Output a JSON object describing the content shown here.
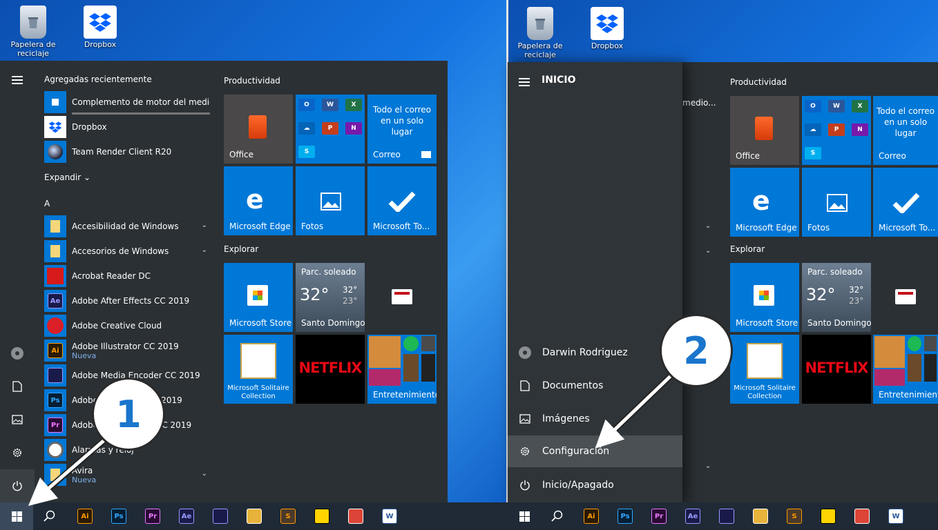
{
  "desktop": {
    "icons": [
      {
        "label": "Papelera de reciclaje",
        "icon": "recycle-bin-icon"
      },
      {
        "label": "Dropbox",
        "icon": "dropbox-icon"
      }
    ]
  },
  "left_menu": {
    "recent_header": "Agregadas recientemente",
    "recent": [
      {
        "label": "Complemento de motor del medio...",
        "color": "#0078d7"
      },
      {
        "label": "Dropbox",
        "color": "#0078d7"
      },
      {
        "label": "Team Render Client R20",
        "color": "#0078d7"
      }
    ],
    "expand_label": "Expandir",
    "section_letter": "A",
    "apps": [
      {
        "label": "Accesibilidad de Windows",
        "icon_text": "",
        "color": "#0078d7",
        "sub": "",
        "chev": "⌄"
      },
      {
        "label": "Accesorios de Windows",
        "icon_text": "",
        "color": "#0078d7",
        "sub": "",
        "chev": "⌄"
      },
      {
        "label": "Acrobat Reader DC",
        "icon_text": "",
        "color": "#0078d7",
        "sub": "",
        "chev": ""
      },
      {
        "label": "Adobe After Effects CC 2019",
        "icon_text": "Ae",
        "color": "#1a1a4a",
        "sub": "",
        "chev": ""
      },
      {
        "label": "Adobe Creative Cloud",
        "icon_text": "",
        "color": "#0078d7",
        "sub": "",
        "chev": ""
      },
      {
        "label": "Adobe Illustrator CC 2019",
        "icon_text": "Ai",
        "color": "#2a1a04",
        "sub": "Nueva",
        "chev": ""
      },
      {
        "label": "Adobe Media Encoder CC 2019",
        "icon_text": "",
        "color": "#1a1a4a",
        "sub": "",
        "chev": ""
      },
      {
        "label": "Adobe Photoshop CC 2019",
        "icon_text": "Ps",
        "color": "#061e33",
        "sub": "",
        "chev": ""
      },
      {
        "label": "Adobe Premiere Pro CC 2019",
        "icon_text": "Pr",
        "color": "#2a0a33",
        "sub": "",
        "chev": ""
      },
      {
        "label": "Alarmas y reloj",
        "icon_text": "",
        "color": "#0078d7",
        "sub": "",
        "chev": ""
      },
      {
        "label": "Avira",
        "icon_text": "",
        "color": "#0078d7",
        "sub": "Nueva",
        "chev": "⌄"
      }
    ]
  },
  "tiles": {
    "productividad": "Productividad",
    "explorar": "Explorar",
    "office": "Office",
    "correo_text": "Todo el correo en un solo lugar",
    "correo": "Correo",
    "edge": "Microsoft Edge",
    "fotos": "Fotos",
    "todo": "Microsoft To...",
    "store": "Microsoft Store",
    "weather_cond": "Parc. soleado",
    "weather_temp": "32°",
    "weather_high": "32°",
    "weather_low": "23°",
    "weather_city": "Santo Domingo",
    "solitaire": "Microsoft Solitaire Collection",
    "netflix": "NETFLIX",
    "entretenimiento": "Entretenimiento",
    "mini_labels": [
      "O",
      "W",
      "X",
      "",
      "P",
      "N",
      "S"
    ]
  },
  "drawer": {
    "title": "INICIO",
    "partial_text": "medio...",
    "user": "Darwin Rodriguez",
    "documents": "Documentos",
    "images": "Imágenes",
    "settings": "Configuración",
    "power": "Inicio/Apagado"
  },
  "taskbar": {
    "apps": [
      {
        "label": "Ai",
        "color": "#2a1a04",
        "fg": "#ff9a00"
      },
      {
        "label": "Ps",
        "color": "#061e33",
        "fg": "#31a8ff"
      },
      {
        "label": "Pr",
        "color": "#2a0a33",
        "fg": "#ea77ff"
      },
      {
        "label": "Ae",
        "color": "#1a1a4a",
        "fg": "#9999ff"
      },
      {
        "label": "",
        "color": "#1a1a4a",
        "fg": "#9999ff"
      },
      {
        "label": "",
        "color": "#e8b33a",
        "fg": "#fff"
      },
      {
        "label": "S",
        "color": "#4a3a2a",
        "fg": "#ff9800"
      },
      {
        "label": "",
        "color": "#ffd400",
        "fg": "#000"
      },
      {
        "label": "",
        "color": "#db4437",
        "fg": "#fff"
      },
      {
        "label": "W",
        "color": "#ffffff",
        "fg": "#2b579a"
      }
    ]
  },
  "callouts": [
    "1",
    "2"
  ]
}
